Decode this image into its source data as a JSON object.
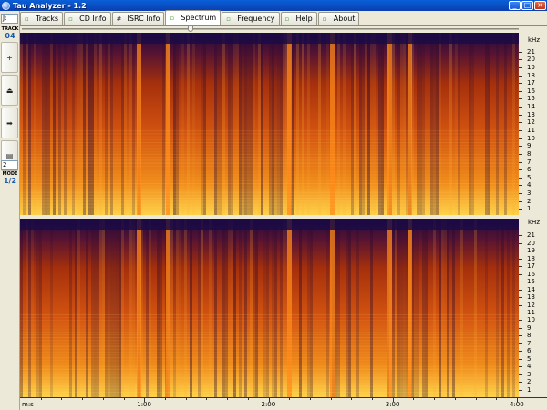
{
  "window": {
    "title": "Tau Analyzer - 1.2",
    "min": "_",
    "max": "□",
    "close": "×"
  },
  "tabs": [
    {
      "label": "Tracks",
      "icon": "check-icon"
    },
    {
      "label": "CD Info",
      "icon": "check-icon"
    },
    {
      "label": "ISRC Info",
      "icon": "hash-icon"
    },
    {
      "label": "Spectrum",
      "icon": "check-icon",
      "active": true
    },
    {
      "label": "Frequency",
      "icon": "check-icon"
    },
    {
      "label": "Help",
      "icon": "check-icon"
    },
    {
      "label": "About",
      "icon": "check-icon"
    }
  ],
  "toolbar": {
    "drive": "J:",
    "track_label": "TRACK",
    "track_value": "04",
    "buttons": [
      "+",
      "⏏",
      "➡",
      "▤"
    ],
    "mode_select": "2",
    "mode_label": "MODE",
    "mode_value": "1/2"
  },
  "freq_axis": {
    "unit": "kHz",
    "labels": [
      "21",
      "20",
      "19",
      "18",
      "17",
      "16",
      "15",
      "14",
      "13",
      "12",
      "11",
      "10",
      "9",
      "8",
      "7",
      "6",
      "5",
      "4",
      "3",
      "2",
      "1"
    ]
  },
  "time_axis": {
    "unit_label": "m:s",
    "labels": [
      "1:00",
      "2:00",
      "3:00",
      "4:00"
    ]
  },
  "slider": {
    "position": 0.34
  },
  "colors": {
    "spectrum_bright": "#ffdd44",
    "spectrum_mid": "#e05a10",
    "spectrum_dark": "#2a0c4a"
  }
}
